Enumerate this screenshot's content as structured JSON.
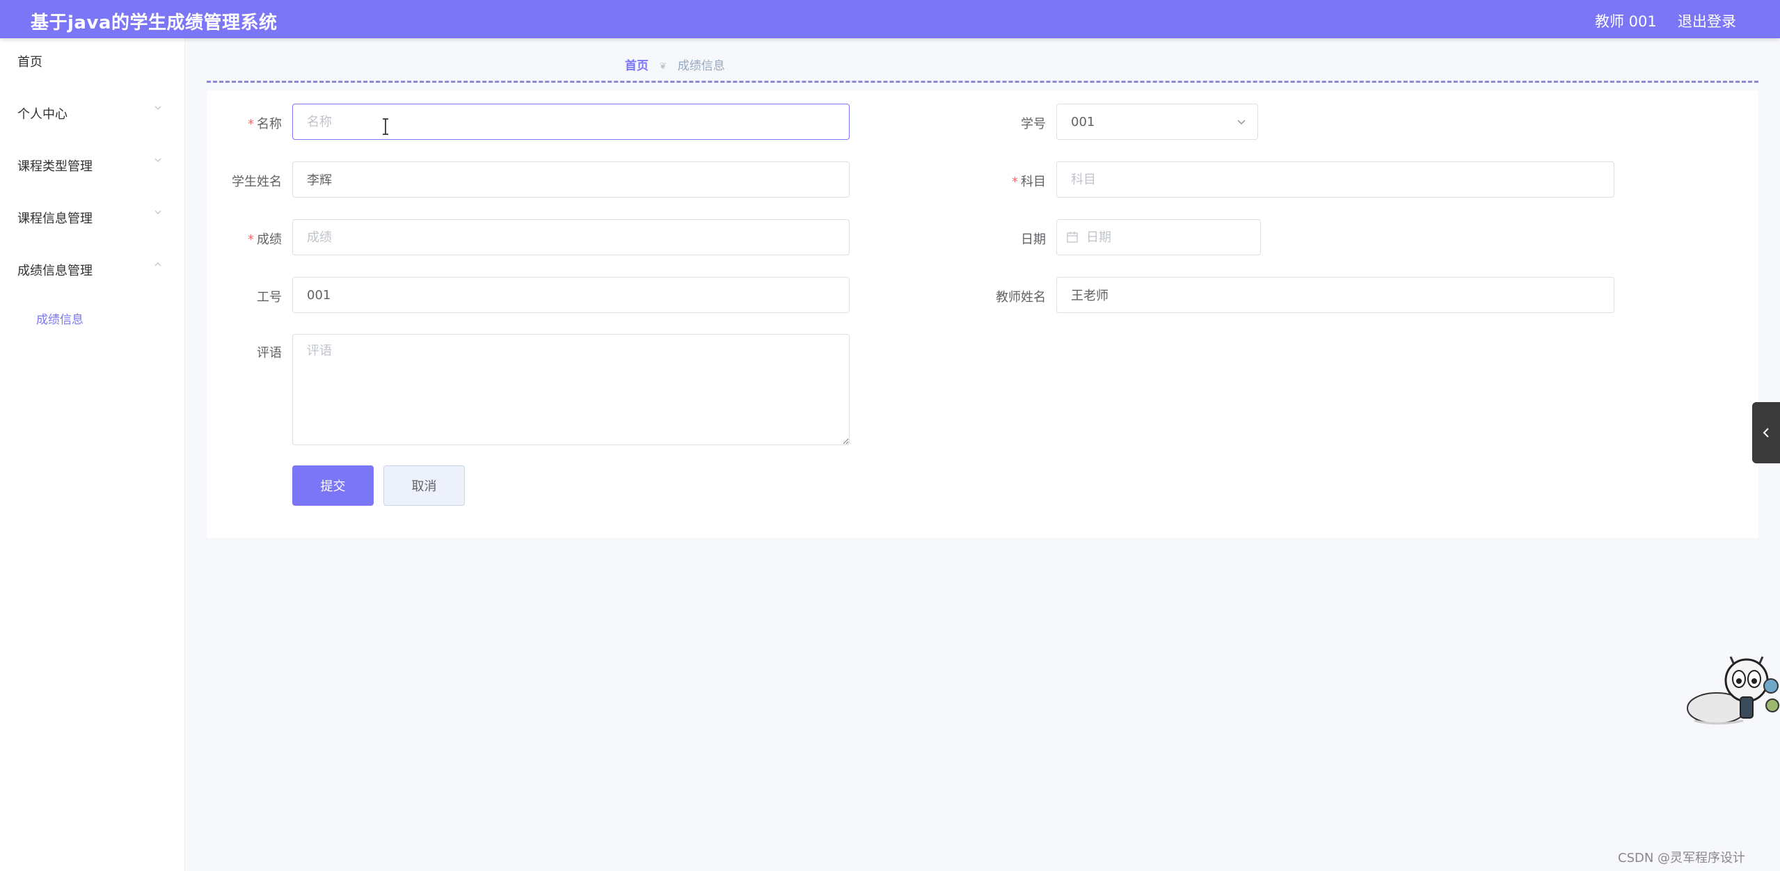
{
  "header": {
    "title": "基于java的学生成绩管理系统",
    "user": "教师 001",
    "logout": "退出登录"
  },
  "sidebar": {
    "items": [
      {
        "label": "首页"
      },
      {
        "label": "个人中心"
      },
      {
        "label": "课程类型管理"
      },
      {
        "label": "课程信息管理"
      },
      {
        "label": "成绩信息管理"
      }
    ],
    "sub_item": "成绩信息"
  },
  "breadcrumb": {
    "home": "首页",
    "current": "成绩信息"
  },
  "form": {
    "name": {
      "label": "名称",
      "placeholder": "名称",
      "value": ""
    },
    "student_id": {
      "label": "学号",
      "value": "001"
    },
    "student_name": {
      "label": "学生姓名",
      "value": "李辉"
    },
    "subject": {
      "label": "科目",
      "placeholder": "科目",
      "value": ""
    },
    "score": {
      "label": "成绩",
      "placeholder": "成绩",
      "value": ""
    },
    "date": {
      "label": "日期",
      "placeholder": "日期",
      "value": ""
    },
    "job_no": {
      "label": "工号",
      "value": "001"
    },
    "teacher_name": {
      "label": "教师姓名",
      "value": "王老师"
    },
    "comment": {
      "label": "评语",
      "placeholder": "评语",
      "value": ""
    },
    "required_mark": "*",
    "submit": "提交",
    "cancel": "取消"
  },
  "watermark": "CSDN @灵军程序设计",
  "colors": {
    "accent": "#7b76f5",
    "required": "#f56c6c",
    "breadcrumb_current": "#97a8be"
  }
}
